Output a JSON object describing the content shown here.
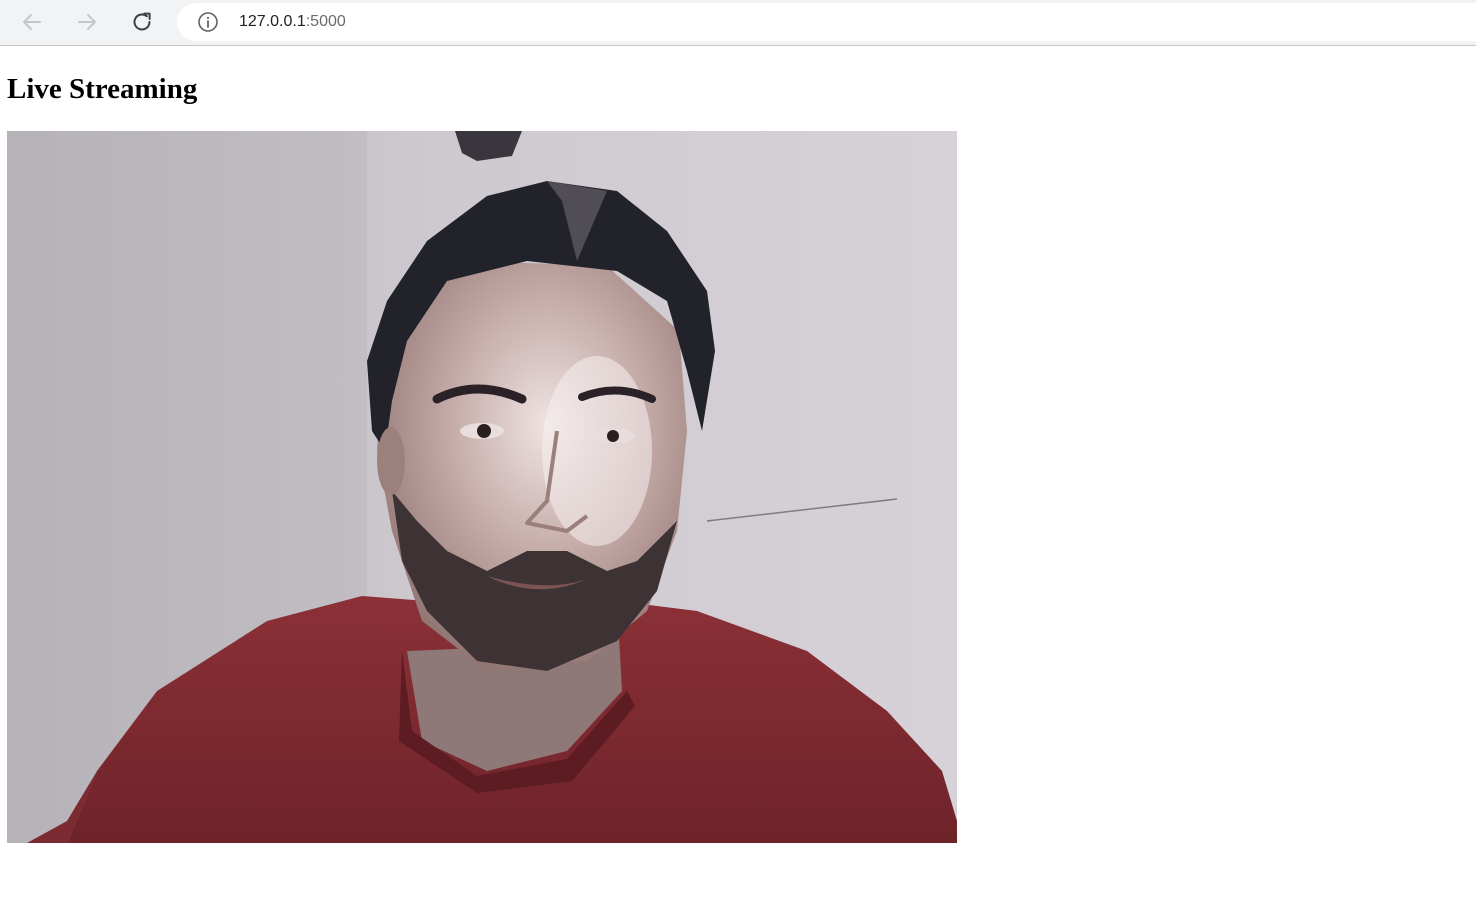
{
  "browser": {
    "back_icon": "arrow-left-icon",
    "forward_icon": "arrow-right-icon",
    "reload_icon": "reload-icon",
    "site_info_icon": "info-icon",
    "url_host": "127.0.0.1",
    "url_port": ":5000"
  },
  "page": {
    "title": "Live Streaming",
    "video_stream": {
      "content": "webcam frame of a bearded man in a maroon t-shirt against a light grey wall"
    }
  },
  "colors": {
    "toolbar_bg": "#f1f3f4",
    "address_bar_bg": "#ffffff",
    "wall": "#c9c5cb",
    "shirt": "#7e2a30",
    "hair": "#23232a",
    "skin": "#b79a96"
  }
}
